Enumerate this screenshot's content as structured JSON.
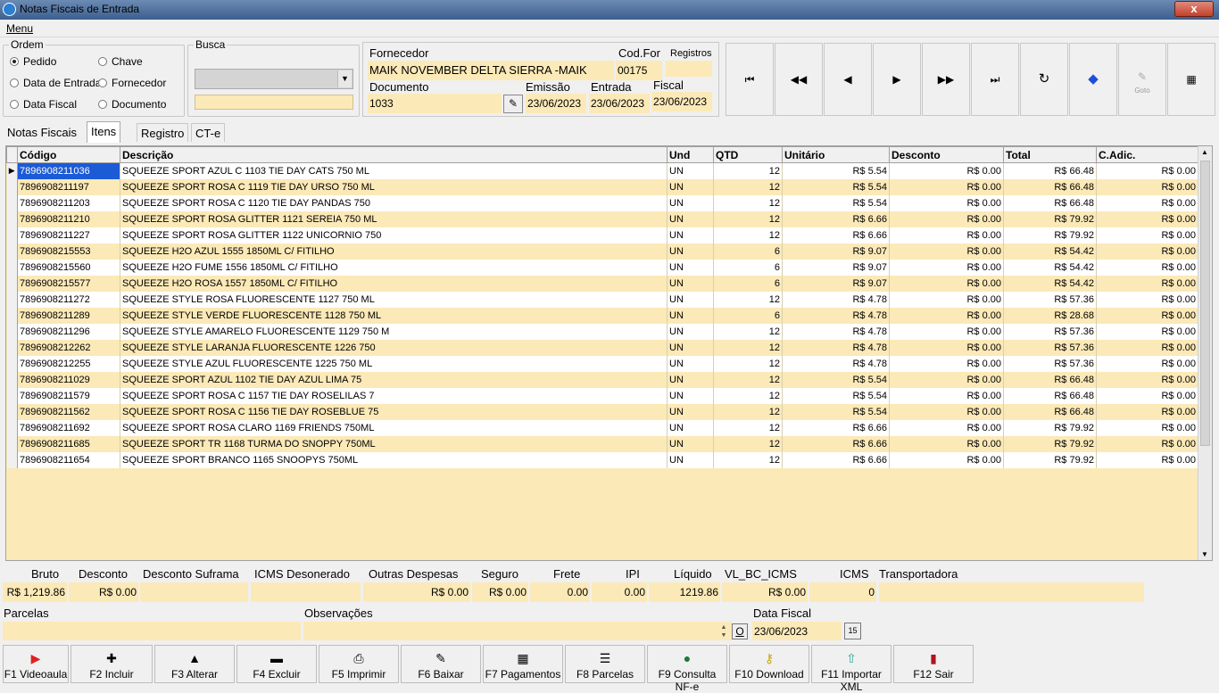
{
  "window": {
    "title": "Notas Fiscais de Entrada",
    "close": "x"
  },
  "menu": {
    "label": "Menu"
  },
  "ordem": {
    "legend": "Ordem",
    "options": [
      "Pedido",
      "Chave",
      "Data de Entrada",
      "Fornecedor",
      "Data Fiscal",
      "Documento"
    ],
    "selected": "Pedido"
  },
  "busca": {
    "legend": "Busca",
    "select_value": "",
    "text_value": ""
  },
  "header": {
    "fornecedor_label": "Fornecedor",
    "fornecedor": "MAIK NOVEMBER DELTA SIERRA -MAIK",
    "codfor_label": "Cod.For",
    "codfor": "00175",
    "registros_label": "Registros",
    "registros": "",
    "documento_label": "Documento",
    "documento": "1033",
    "emissao_label": "Emissão",
    "emissao": "23/06/2023",
    "entrada_label": "Entrada",
    "entrada": "23/06/2023",
    "fiscal_label": "Fiscal",
    "fiscal": "23/06/2023"
  },
  "nav": {
    "first": "first-icon",
    "prev_page": "rewind-icon",
    "prev": "prev-icon",
    "next": "next-icon",
    "next_page": "fast-forward-icon",
    "last": "last-icon",
    "refresh": "refresh-icon",
    "tag": "tag-icon",
    "goto": "goto-icon",
    "goto_label": "Goto",
    "calc": "calculator-icon"
  },
  "tabs": [
    "Notas Fiscais",
    "Itens",
    "Registro",
    "CT-e"
  ],
  "grid": {
    "columns": [
      "Código",
      "Descrição",
      "Und",
      "QTD",
      "Unitário",
      "Desconto",
      "Total",
      "C.Adic."
    ],
    "rows": [
      [
        "7896908211036",
        "SQUEEZE SPORT AZUL C 1103 TIE DAY CATS 750 ML",
        "UN",
        "12",
        "R$ 5.54",
        "R$ 0.00",
        "R$ 66.48",
        "R$ 0.00"
      ],
      [
        "7896908211197",
        "SQUEEZE SPORT ROSA C 1119 TIE DAY URSO 750 ML",
        "UN",
        "12",
        "R$ 5.54",
        "R$ 0.00",
        "R$ 66.48",
        "R$ 0.00"
      ],
      [
        "7896908211203",
        "SQUEEZE SPORT ROSA C 1120 TIE DAY PANDAS 750",
        "UN",
        "12",
        "R$ 5.54",
        "R$ 0.00",
        "R$ 66.48",
        "R$ 0.00"
      ],
      [
        "7896908211210",
        "SQUEEZE SPORT ROSA GLITTER 1121 SEREIA 750 ML",
        "UN",
        "12",
        "R$ 6.66",
        "R$ 0.00",
        "R$ 79.92",
        "R$ 0.00"
      ],
      [
        "7896908211227",
        "SQUEEZE SPORT ROSA GLITTER 1122 UNICORNIO 750",
        "UN",
        "12",
        "R$ 6.66",
        "R$ 0.00",
        "R$ 79.92",
        "R$ 0.00"
      ],
      [
        "7896908215553",
        "SQUEEZE H2O AZUL 1555 1850ML C/ FITILHO",
        "UN",
        "6",
        "R$ 9.07",
        "R$ 0.00",
        "R$ 54.42",
        "R$ 0.00"
      ],
      [
        "7896908215560",
        "SQUEEZE H2O FUME 1556 1850ML C/ FITILHO",
        "UN",
        "6",
        "R$ 9.07",
        "R$ 0.00",
        "R$ 54.42",
        "R$ 0.00"
      ],
      [
        "7896908215577",
        "SQUEEZE H2O ROSA 1557 1850ML C/ FITILHO",
        "UN",
        "6",
        "R$ 9.07",
        "R$ 0.00",
        "R$ 54.42",
        "R$ 0.00"
      ],
      [
        "7896908211272",
        "SQUEEZE STYLE ROSA FLUORESCENTE 1127 750 ML",
        "UN",
        "12",
        "R$ 4.78",
        "R$ 0.00",
        "R$ 57.36",
        "R$ 0.00"
      ],
      [
        "7896908211289",
        "SQUEEZE STYLE VERDE FLUORESCENTE 1128 750 ML",
        "UN",
        "6",
        "R$ 4.78",
        "R$ 0.00",
        "R$ 28.68",
        "R$ 0.00"
      ],
      [
        "7896908211296",
        "SQUEEZE STYLE AMARELO FLUORESCENTE 1129 750 M",
        "UN",
        "12",
        "R$ 4.78",
        "R$ 0.00",
        "R$ 57.36",
        "R$ 0.00"
      ],
      [
        "7896908212262",
        "SQUEEZE STYLE LARANJA FLUORESCENTE 1226 750",
        "UN",
        "12",
        "R$ 4.78",
        "R$ 0.00",
        "R$ 57.36",
        "R$ 0.00"
      ],
      [
        "7896908212255",
        "SQUEEZE STYLE AZUL FLUORESCENTE 1225 750 ML",
        "UN",
        "12",
        "R$ 4.78",
        "R$ 0.00",
        "R$ 57.36",
        "R$ 0.00"
      ],
      [
        "7896908211029",
        "SQUEEZE SPORT AZUL 1102 TIE DAY AZUL LIMA 75",
        "UN",
        "12",
        "R$ 5.54",
        "R$ 0.00",
        "R$ 66.48",
        "R$ 0.00"
      ],
      [
        "7896908211579",
        "SQUEEZE SPORT ROSA C 1157 TIE DAY ROSELILAS 7",
        "UN",
        "12",
        "R$ 5.54",
        "R$ 0.00",
        "R$ 66.48",
        "R$ 0.00"
      ],
      [
        "7896908211562",
        "SQUEEZE SPORT ROSA C 1156 TIE DAY ROSEBLUE 75",
        "UN",
        "12",
        "R$ 5.54",
        "R$ 0.00",
        "R$ 66.48",
        "R$ 0.00"
      ],
      [
        "7896908211692",
        "SQUEEZE SPORT ROSA CLARO 1169 FRIENDS 750ML",
        "UN",
        "12",
        "R$ 6.66",
        "R$ 0.00",
        "R$ 79.92",
        "R$ 0.00"
      ],
      [
        "7896908211685",
        "SQUEEZE SPORT TR 1168 TURMA DO SNOPPY 750ML",
        "UN",
        "12",
        "R$ 6.66",
        "R$ 0.00",
        "R$ 79.92",
        "R$ 0.00"
      ],
      [
        "7896908211654",
        "SQUEEZE SPORT BRANCO 1165 SNOOPYS 750ML",
        "UN",
        "12",
        "R$ 6.66",
        "R$ 0.00",
        "R$ 79.92",
        "R$ 0.00"
      ]
    ]
  },
  "totals": {
    "bruto_label": "Bruto",
    "bruto": "R$ 1,219.86",
    "desconto_label": "Desconto",
    "desconto": "R$ 0.00",
    "suframa_label": "Desconto Suframa",
    "suframa": "",
    "icmsdes_label": "ICMS Desonerado",
    "icmsdes": "",
    "outras_label": "Outras Despesas",
    "outras": "R$ 0.00",
    "seguro_label": "Seguro",
    "seguro": "R$ 0.00",
    "frete_label": "Frete",
    "frete": "0.00",
    "ipi_label": "IPI",
    "ipi": "0.00",
    "liquido_label": "Líquido",
    "liquido": "1219.86",
    "vlbc_label": "VL_BC_ICMS",
    "vlbc": "R$ 0.00",
    "icms_label": "ICMS",
    "icms": "0",
    "transp_label": "Transportadora",
    "transp": ""
  },
  "footer_fields": {
    "parcelas_label": "Parcelas",
    "parcelas": "",
    "obs_label": "Observações",
    "obs": "",
    "obs_btn": "O",
    "datafiscal_label": "Data Fiscal",
    "datafiscal": "23/06/2023",
    "cal_btn": "15"
  },
  "buttons": [
    {
      "label": "F1 Videoaula",
      "icon": "video-icon"
    },
    {
      "label": "F2 Incluir",
      "icon": "plus-icon"
    },
    {
      "label": "F3 Alterar",
      "icon": "up-triangle-icon"
    },
    {
      "label": "F4 Excluir",
      "icon": "minus-icon"
    },
    {
      "label": "F5 Imprimir",
      "icon": "printer-icon"
    },
    {
      "label": "F6 Baixar",
      "icon": "check-doc-icon"
    },
    {
      "label": "F7 Pagamentos",
      "icon": "calculator-icon"
    },
    {
      "label": "F8 Parcelas",
      "icon": "list-icon"
    },
    {
      "label": "F9 Consulta NF-e",
      "icon": "globe-icon"
    },
    {
      "label": "F10 Download",
      "icon": "key-icon"
    },
    {
      "label": "F11 Importar XML",
      "icon": "upload-icon"
    },
    {
      "label": "F12 Sair",
      "icon": "exit-door-icon"
    }
  ]
}
